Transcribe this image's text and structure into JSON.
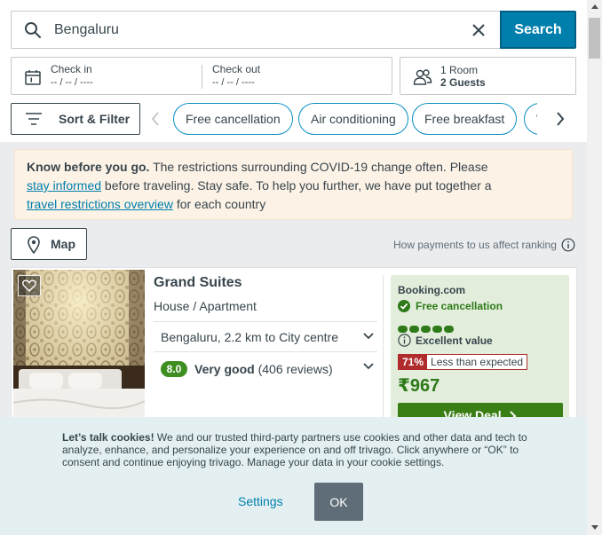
{
  "search": {
    "value": "Bengaluru",
    "button_label": "Search"
  },
  "dates": {
    "checkin_label": "Check in",
    "checkin_value": "-- / -- / ----",
    "checkout_label": "Check out",
    "checkout_value": "-- / -- / ----"
  },
  "guests": {
    "rooms": "1 Room",
    "guests": "2 Guests"
  },
  "filters": {
    "sort_label": "Sort & Filter",
    "chips": [
      "Free cancellation",
      "Air conditioning",
      "Free breakfast",
      "Wi-Fi"
    ]
  },
  "notice": {
    "bold": "Know before you go.",
    "text1": " The restrictions surrounding COVID-19 change often. Please ",
    "link1": "stay informed",
    "text2": " before traveling. Stay safe. To help you further, we have put together a ",
    "link2": "travel restrictions overview",
    "text3": " for each country"
  },
  "map": {
    "label": "Map",
    "ranking_text": "How payments to us affect ranking"
  },
  "hotel": {
    "name": "Grand Suites",
    "type": "House / Apartment",
    "location": "Bengaluru, 2.2 km to City centre",
    "rating": "8.0",
    "rating_label": "Very good",
    "reviews": "(406 reviews)",
    "deal": {
      "provider": "Booking.com",
      "cancellation": "Free cancellation",
      "value_label": "Excellent value",
      "value_dots": 5,
      "percent": "71%",
      "percent_text": "Less than expected",
      "price": "₹967",
      "button": "View Deal"
    }
  },
  "cookies": {
    "bold": "Let’s talk cookies!",
    "text": " We and our trusted third-party partners use cookies and other data and tech to analyze, enhance, and personalize your experience on and off trivago. Click anywhere or “OK” to consent and continue enjoying trivago. Manage your data in your cookie settings.",
    "settings": "Settings",
    "ok": "OK"
  },
  "colors": {
    "accent": "#007fad",
    "deal_green": "#3a7f16",
    "rating_green": "#3e8e20",
    "alert_red": "#b02c2c"
  }
}
